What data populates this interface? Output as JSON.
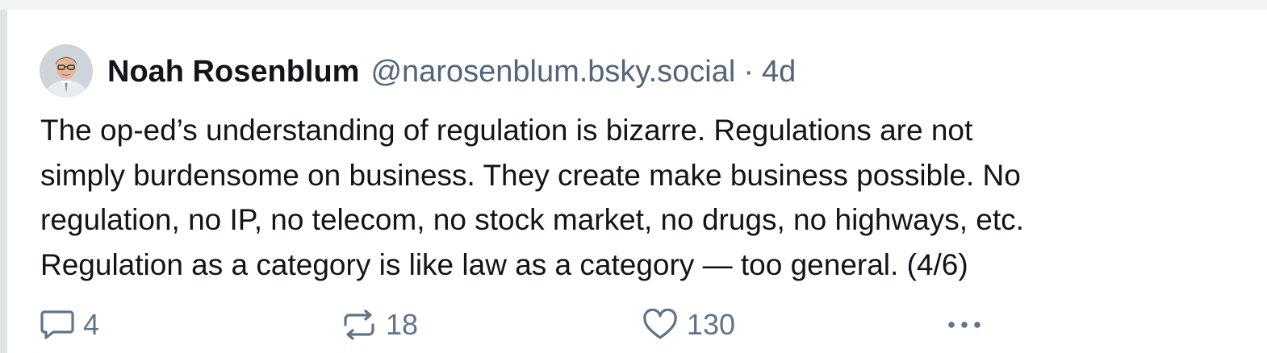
{
  "post": {
    "author": {
      "display_name": "Noah Rosenblum",
      "handle": "@narosenblum.bsky.social",
      "separator": "·",
      "time_ago": "4d",
      "avatar_icon": "user-photo-avatar"
    },
    "text_lines": [
      "The op-ed’s understanding of regulation is bizarre. Regulations are not",
      "simply burdensome on business. They create make business possible. No",
      "regulation, no IP, no telecom, no stock market, no drugs, no highways, etc.",
      "Regulation as a category is like law as a category — too general. (4/6)"
    ],
    "actions": {
      "reply_count": "4",
      "repost_count": "18",
      "like_count": "130"
    }
  },
  "colors": {
    "text_primary": "#111418",
    "text_secondary": "#53657a",
    "icon": "#61748a",
    "thread_line": "#dfe3e8"
  }
}
